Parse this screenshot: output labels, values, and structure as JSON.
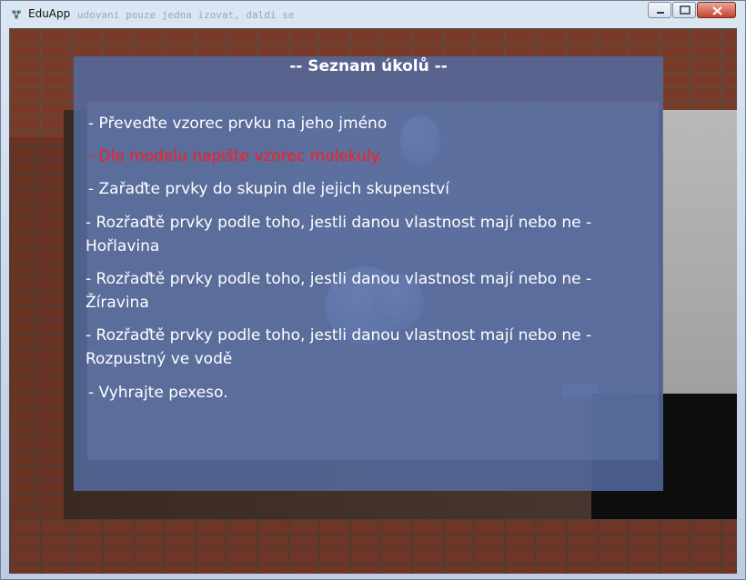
{
  "window": {
    "title": "EduApp",
    "background_text": "udovani pouze jedna izovat, daldi se"
  },
  "panel": {
    "title": "-- Seznam úkolů --",
    "tasks": [
      {
        "line1": " - Převeďte vzorec prvku na jeho jméno",
        "line2": "",
        "color": "#ffffff"
      },
      {
        "line1": " - Dle modelu napište vzorec molekuly.",
        "line2": "",
        "color": "#ff1a1a"
      },
      {
        "line1": " - Zařaďte prvky do skupin dle jejich skupenství",
        "line2": "",
        "color": "#ffffff"
      },
      {
        "line1": "- Rozřaďtě prvky podle toho, jestli danou vlastnost mají nebo ne -",
        "line2": "Hořlavina",
        "color": "#ffffff"
      },
      {
        "line1": "- Rozřaďtě prvky podle toho, jestli danou vlastnost mají nebo ne -",
        "line2": "Žíravina",
        "color": "#ffffff"
      },
      {
        "line1": "- Rozřaďtě prvky podle toho, jestli danou vlastnost mají nebo ne -",
        "line2": "Rozpustný ve vodě",
        "color": "#ffffff"
      },
      {
        "line1": " - Vyhrajte pexeso.",
        "line2": "",
        "color": "#ffffff"
      }
    ]
  },
  "icons": {
    "app": "app-icon",
    "minimize": "minimize-icon",
    "maximize": "maximize-icon",
    "close": "close-icon"
  }
}
